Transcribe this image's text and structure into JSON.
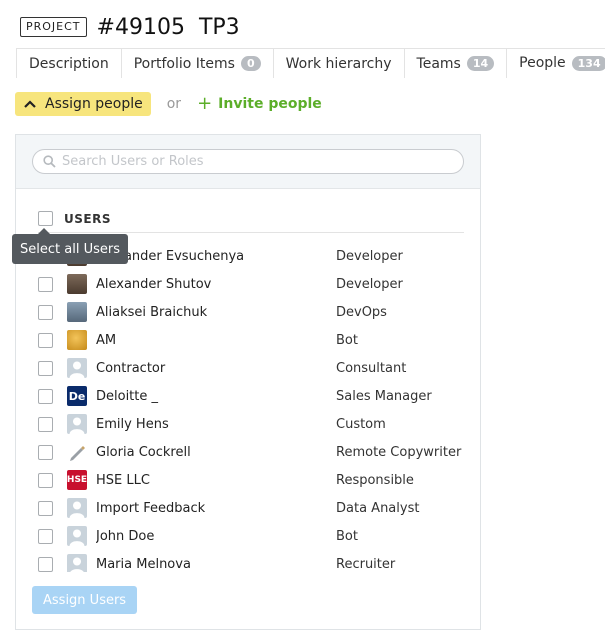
{
  "header": {
    "badge": "PROJECT",
    "id": "#49105",
    "name": "TP3"
  },
  "tabs": [
    {
      "label": "Description",
      "count": null
    },
    {
      "label": "Portfolio Items",
      "count": "0"
    },
    {
      "label": "Work hierarchy",
      "count": null
    },
    {
      "label": "Teams",
      "count": "14"
    },
    {
      "label": "People",
      "count": "134"
    }
  ],
  "actions": {
    "assign_label": "Assign people",
    "or_label": "or",
    "invite_label": "Invite people"
  },
  "panel": {
    "search_placeholder": "Search Users or Roles",
    "header_label": "USERS",
    "tooltip": "Select all Users",
    "submit_label": "Assign Users"
  },
  "users": [
    {
      "name": "Alexander Evsuchenya",
      "role": "Developer",
      "avatar": "photo-avatar"
    },
    {
      "name": "Alexander Shutov",
      "role": "Developer",
      "avatar": "photo-avatar"
    },
    {
      "name": "Aliaksei Braichuk",
      "role": "DevOps",
      "avatar": "photo-avatar"
    },
    {
      "name": "AM",
      "role": "Bot",
      "avatar": "gold-emblem-avatar"
    },
    {
      "name": "Contractor",
      "role": "Consultant",
      "avatar": "person-avatar"
    },
    {
      "name": "Deloitte _",
      "role": "Sales Manager",
      "avatar": "deloitte-logo-avatar"
    },
    {
      "name": "Emily Hens",
      "role": "Custom",
      "avatar": "person-avatar"
    },
    {
      "name": "Gloria Cockrell",
      "role": "Remote Copywriter",
      "avatar": "pen-avatar"
    },
    {
      "name": "HSE LLC",
      "role": "Responsible",
      "avatar": "hse-logo-avatar"
    },
    {
      "name": "Import Feedback",
      "role": "Data Analyst",
      "avatar": "person-avatar"
    },
    {
      "name": "John Doe",
      "role": "Bot",
      "avatar": "person-avatar"
    },
    {
      "name": "Maria Melnova",
      "role": "Recruiter",
      "avatar": "person-avatar"
    }
  ],
  "colors": {
    "assign_button_bg": "#f7e57d",
    "invite_green": "#5cae2a",
    "submit_button_bg": "#a9d4f5",
    "tooltip_bg": "#54595e",
    "count_badge_bg": "#b8bcc1"
  }
}
